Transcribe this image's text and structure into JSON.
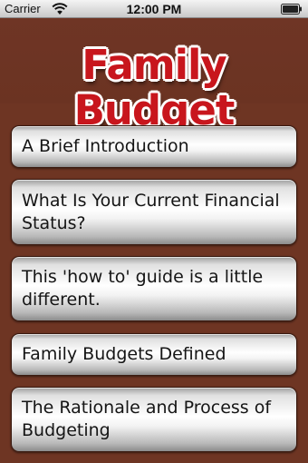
{
  "status_bar": {
    "carrier": "Carrier",
    "time": "12:00 PM"
  },
  "header": {
    "title": "Family Budget"
  },
  "menu": {
    "items": [
      {
        "label": "A Brief Introduction"
      },
      {
        "label": "What Is Your Current Financial Status?"
      },
      {
        "label": "This 'how to' guide is a little different."
      },
      {
        "label": "Family Budgets Defined"
      },
      {
        "label": "The Rationale and Process of Budgeting"
      }
    ]
  },
  "colors": {
    "background": "#6e3523",
    "title_red": "#c8161d",
    "title_outline": "#ffffff"
  }
}
